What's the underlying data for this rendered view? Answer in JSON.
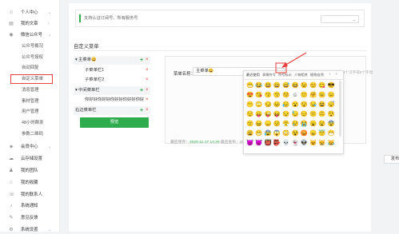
{
  "sidebar": {
    "items": [
      {
        "icon": "person-icon",
        "label": "个人中心",
        "chevron": "⌄"
      },
      {
        "icon": "doc-icon",
        "label": "我的文章",
        "chevron": "›"
      },
      {
        "icon": "wechat-icon",
        "label": "微信公众号",
        "chevron": "⌄"
      }
    ],
    "subitems": [
      "公众号概况",
      "公众号授权",
      "自动回复",
      "自定义菜单",
      "消息管理",
      "素材管理",
      "用户管理",
      "48小时群发",
      "参数二维码"
    ],
    "lower_items": [
      {
        "icon": "member-icon",
        "label": "会员中心",
        "chevron": "⌄"
      },
      {
        "icon": "cloud-icon",
        "label": "云存储设置",
        "chevron": ""
      },
      {
        "icon": "team-icon",
        "label": "我的团队",
        "chevron": ""
      },
      {
        "icon": "favorite-icon",
        "label": "我的收藏",
        "chevron": ""
      },
      {
        "icon": "contact-icon",
        "label": "我的联系人",
        "chevron": ""
      },
      {
        "icon": "bell-icon",
        "label": "系统通知",
        "chevron": ""
      },
      {
        "icon": "feedback-icon",
        "label": "意见反馈",
        "chevron": ""
      },
      {
        "icon": "gear-icon",
        "label": "系统设置",
        "chevron": "⌄"
      }
    ]
  },
  "notice": {
    "text": "支持认证订阅号、所有服务号",
    "select_icon": "⌄"
  },
  "section_title": "自定义菜单",
  "menu_tree": {
    "nodes": [
      {
        "level": 1,
        "label": "▾ 主菜单😀",
        "plus": "+",
        "x": "×"
      },
      {
        "level": 2,
        "label": "子菜单栏1",
        "plus": "",
        "x": "×"
      },
      {
        "level": 2,
        "label": "子菜单栏2",
        "plus": "",
        "x": "×"
      },
      {
        "level": 1,
        "label": "▾ 中间菜单栏",
        "plus": "+",
        "x": "×"
      },
      {
        "level": 2,
        "label": "你好好你好好你好好你好好你好",
        "plus": "",
        "x": "×"
      },
      {
        "level": 1,
        "label": "右边菜单栏",
        "plus": "+",
        "x": "×"
      }
    ],
    "preview_label": "预览"
  },
  "editor": {
    "name_label": "菜单名称：",
    "name_value": "主菜单😀",
    "emoji_button": "☺",
    "hint": "仅支持中英文和数字，字数不超过4个汉字或8个字母",
    "save_prefix": "最后保存：",
    "save_time": "2020-11-17 14:29",
    "save_suffix": "最后发布：2020-11-17 14:29",
    "publish_label": "发布"
  },
  "emoji_panel": {
    "tabs": [
      "最近使用",
      "表情符号",
      "符号标示",
      "人物相关",
      "植物自然"
    ],
    "nav_prev": "‹",
    "nav_next": "›",
    "emojis": [
      "😁",
      "😂",
      "😃",
      "😄",
      "😅",
      "😆",
      "😉",
      "😊",
      "😋",
      "😎",
      "😍",
      "😘",
      "😗",
      "😙",
      "😚",
      "☺",
      "🙂",
      "🤗",
      "😐",
      "😑",
      "😶",
      "🙄",
      "😏",
      "😣",
      "😥",
      "😮",
      "😯",
      "😪",
      "😫",
      "😴",
      "😌",
      "😛",
      "😜",
      "😝",
      "😒",
      "😓",
      "😔",
      "😕",
      "🙃",
      "😲",
      "🙁",
      "😖",
      "😞",
      "😟",
      "😤",
      "😢",
      "😭",
      "😦",
      "😧",
      "😨",
      "😩",
      "😬",
      "😰",
      "😱",
      "😳",
      "😵",
      "😡",
      "😠",
      "😇",
      "😷",
      "😈",
      "👿",
      "👹",
      "👺",
      "💀",
      "👻",
      "👽",
      "😺",
      "😸",
      "😹"
    ]
  },
  "colors": {
    "accent_green": "#2fad4e",
    "highlight_red": "#e8413b"
  }
}
